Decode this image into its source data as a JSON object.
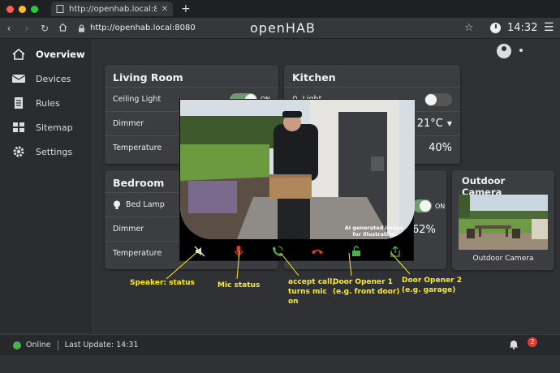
{
  "browser": {
    "tab_title": "http://openhab.local:8080",
    "url": "http://openhab.local:8080",
    "brand": "openHAB",
    "time": "14:32",
    "colors": {
      "close": "#ff5f57",
      "minimize": "#febc2e",
      "maximize": "#28c840"
    }
  },
  "sidebar": {
    "items": [
      {
        "label": "Overview",
        "icon": "home-icon"
      },
      {
        "label": "Devices",
        "icon": "devices-icon"
      },
      {
        "label": "Rules",
        "icon": "rules-icon"
      },
      {
        "label": "Sitemap",
        "icon": "sitemap-icon"
      },
      {
        "label": "Settings",
        "icon": "gear-icon"
      }
    ]
  },
  "living_room": {
    "title": "Living Room",
    "ceiling_light": "Ceiling Light",
    "ceiling_state": "ON",
    "dimmer": "Dimmer",
    "temperature": "Temperature"
  },
  "kitchen": {
    "title": "Kitchen",
    "light": "Light",
    "temp_value": "21°C",
    "percent_value": "40%"
  },
  "bedroom": {
    "title": "Bedroom",
    "bed_lamp": "Bed Lamp",
    "dimmer": "Dimmer",
    "temperature": "Temperature"
  },
  "hidden_card": {
    "state": "ON",
    "percent_value": "62%"
  },
  "outdoor_camera": {
    "title": "Outdoor Camera",
    "caption": "Outdoor Camera"
  },
  "video": {
    "ai_note_line1": "AI generated image",
    "ai_note_line2": "for illustration"
  },
  "annotations": {
    "speaker": "Speaker: status",
    "mic": "Mic status",
    "accept_1": "accept call,",
    "accept_2": "turns  mic",
    "accept_3": "on",
    "door1_1": "Door Opener 1",
    "door1_2": "(e.g. front door)",
    "door2_1": "Door Opener 2",
    "door2_2": "(e.g. garage)"
  },
  "status": {
    "online": "Online",
    "last_update": "Last Update: 14:31",
    "notifications": "2"
  }
}
